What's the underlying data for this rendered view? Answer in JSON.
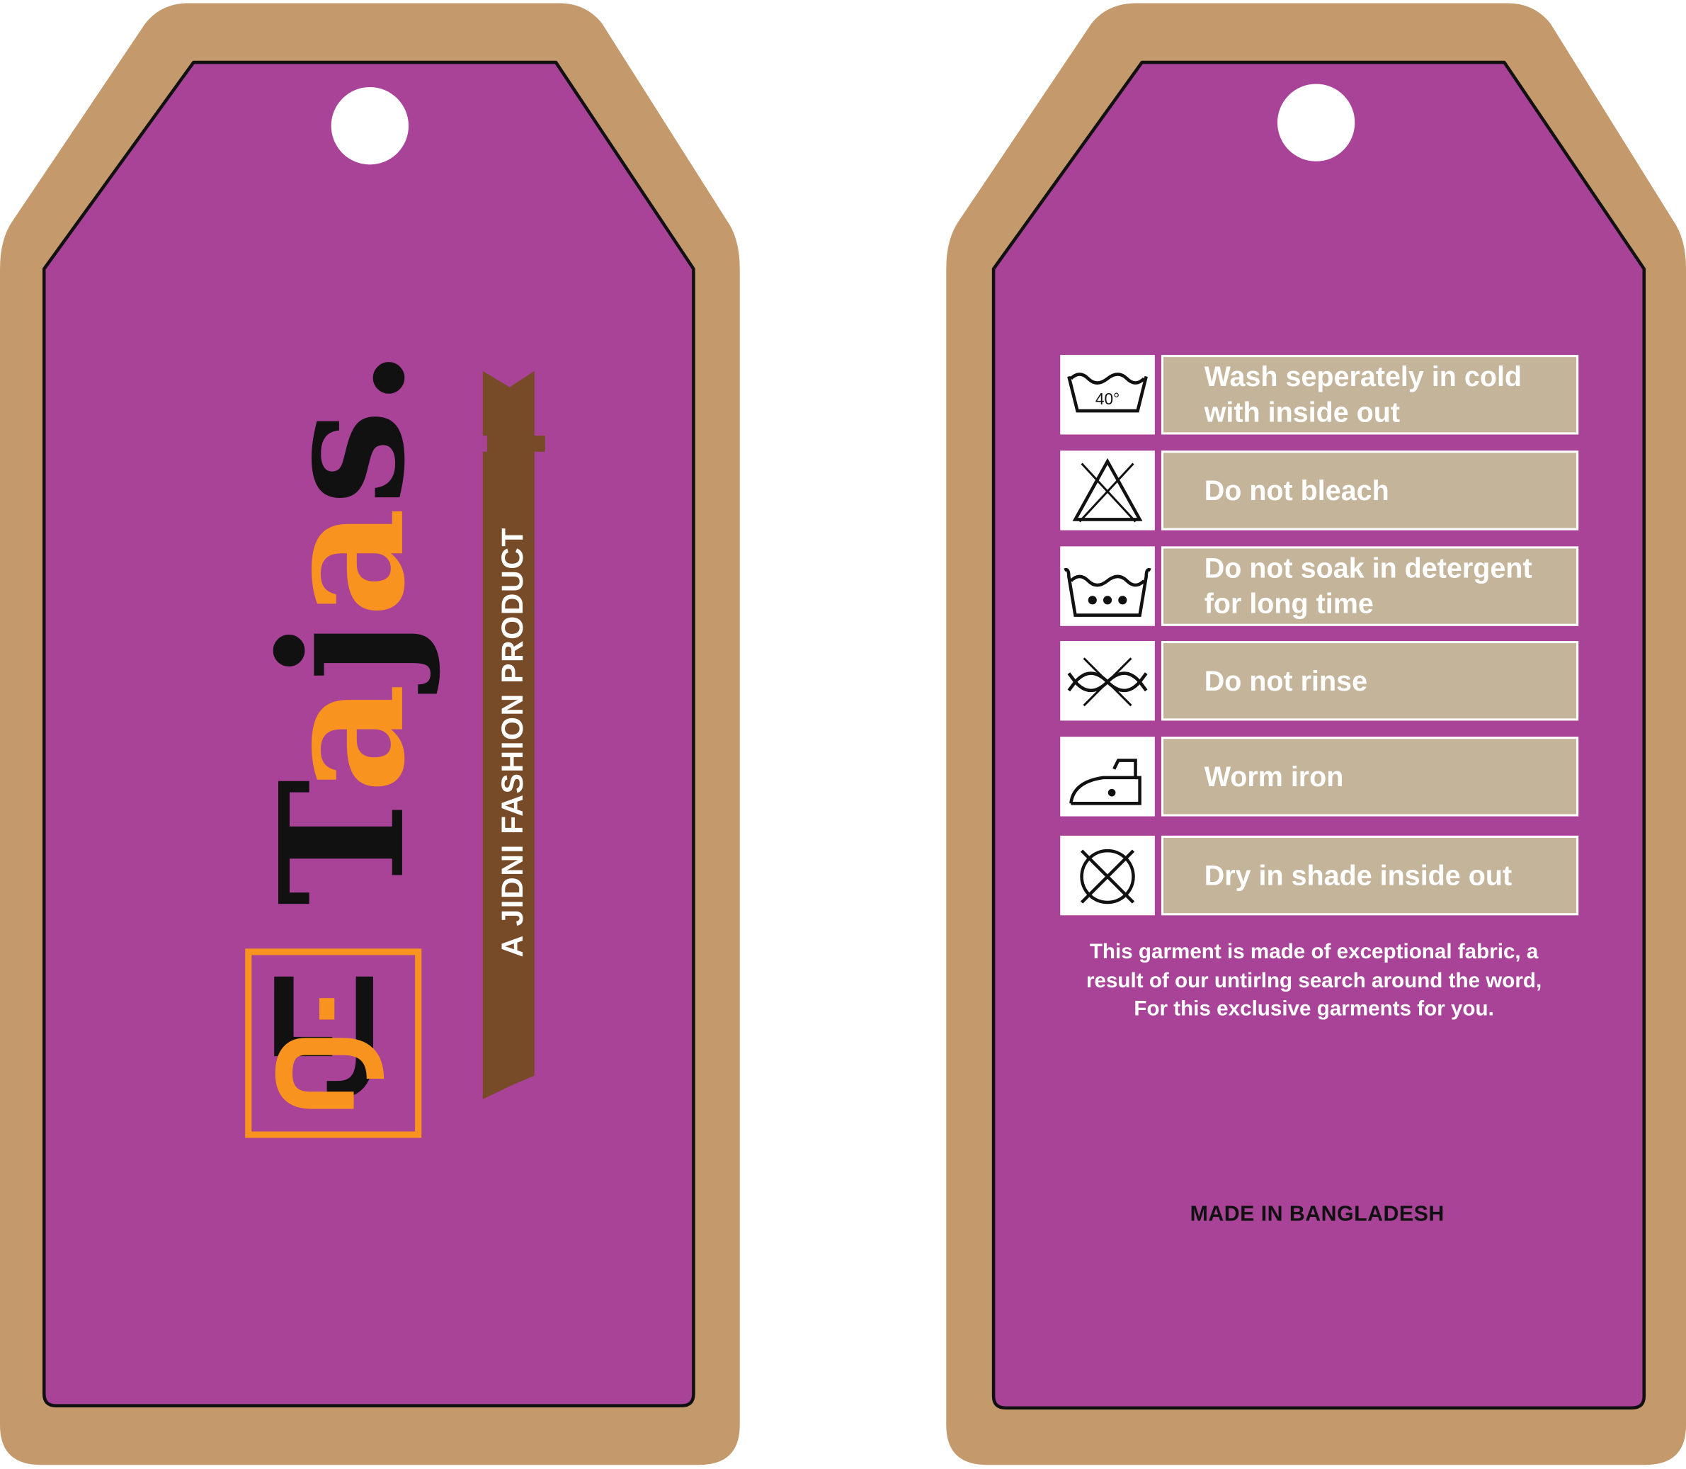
{
  "colors": {
    "kraft_border": "#c4996b",
    "tag_purple": "#a84398",
    "brand_orange": "#f7931e",
    "brand_black": "#111111",
    "ribbon_brown": "#774b28",
    "care_label_bg": "#c4b49a"
  },
  "front": {
    "brand_letters": [
      {
        "char": "T",
        "color": "black"
      },
      {
        "char": "a",
        "color": "orange"
      },
      {
        "char": "j",
        "color": "black"
      },
      {
        "char": "a",
        "color": "orange"
      },
      {
        "char": "s",
        "color": "black"
      },
      {
        "char": ".",
        "color": "black"
      }
    ],
    "monogram": "SJ",
    "tagline": "A JIDNI FASHION PRODUCT"
  },
  "back": {
    "care_items": [
      {
        "icon": "wash-40-icon",
        "icon_text": "40°",
        "label": "Wash seperately in cold with inside out"
      },
      {
        "icon": "do-not-bleach-icon",
        "label": "Do not bleach"
      },
      {
        "icon": "do-not-soak-icon",
        "label": "Do not soak in detergent for long time"
      },
      {
        "icon": "do-not-wring-icon",
        "label": "Do not rinse"
      },
      {
        "icon": "warm-iron-icon",
        "label": "Worm iron"
      },
      {
        "icon": "do-not-tumble-dry-icon",
        "label": "Dry in shade inside out"
      }
    ],
    "note": "This garment is made of exceptional fabric, a result of our untirlng search around the word, For this exclusive garments for you.",
    "origin": "MADE IN BANGLADESH"
  }
}
